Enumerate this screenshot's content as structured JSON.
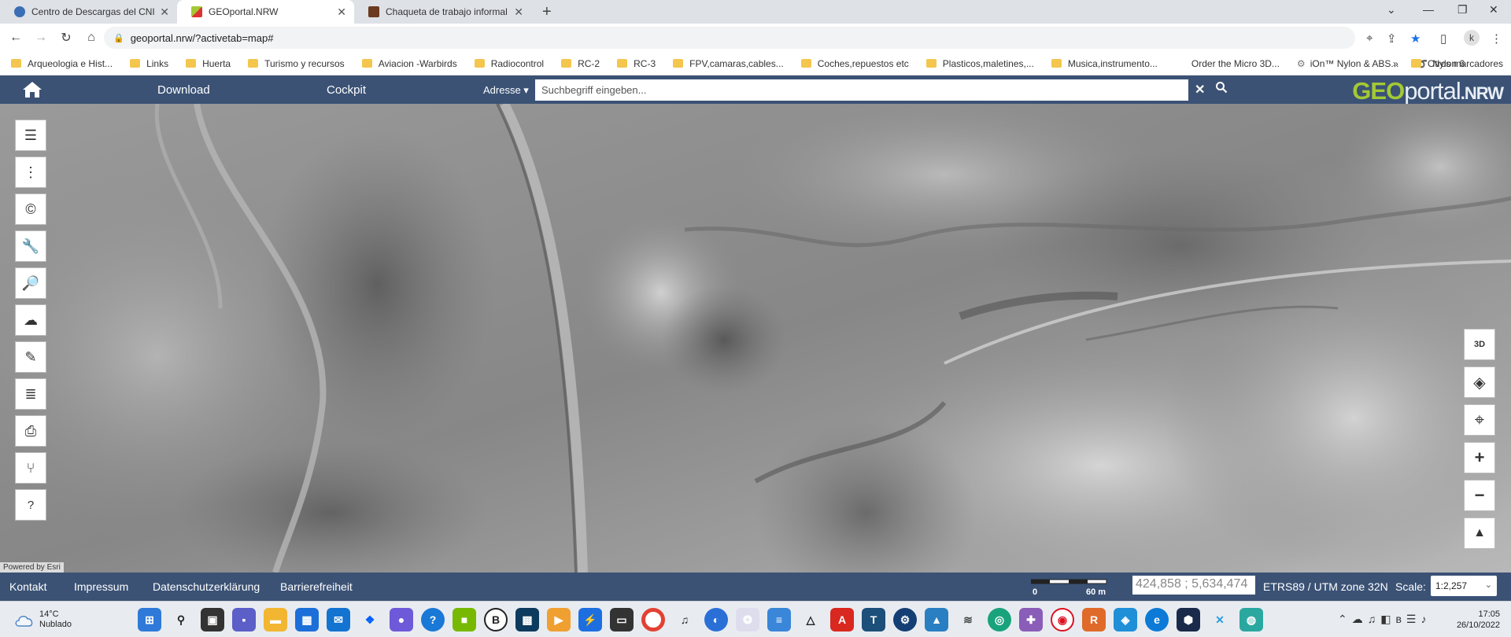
{
  "browser": {
    "tabs": [
      {
        "title": "Centro de Descargas del CNIG (IGN",
        "icon": "globe-icon",
        "active": false
      },
      {
        "title": "GEOportal.NRW",
        "icon": "geoportal-favicon",
        "active": true
      },
      {
        "title": "Chaqueta de trabajo informal cál",
        "icon": "shop-favicon",
        "active": false
      }
    ],
    "url": "geoportal.nrw/?activetab=map#",
    "profile_initial": "k",
    "bookmarks": [
      "Arqueologia e Hist...",
      "Links",
      "Huerta",
      "Turismo y recursos",
      "Aviacion -Warbirds",
      "Radiocontrol",
      "RC-2",
      "RC-3",
      "FPV,camaras,cables...",
      "Coches,repuestos etc",
      "Plasticos,maletines,...",
      "Musica,instrumento...",
      "Order the Micro 3D...",
      "iOn™ Nylon & ABS...",
      "Nylon 6"
    ],
    "bookmarks_more": "»",
    "bookmarks_other": "Otros marcadores"
  },
  "portal": {
    "nav": {
      "download": "Download",
      "cockpit": "Cockpit"
    },
    "search": {
      "scope": "Adresse ▾",
      "placeholder": "Suchbegriff eingeben..."
    },
    "logo": {
      "geo": "GEO",
      "portal": "portal",
      "nrw": ".NRW"
    },
    "colors": {
      "header": "#3b5275",
      "logo_green": "#a3c934"
    }
  },
  "left_tools": [
    {
      "name": "layer-list-icon",
      "glyph": "☰"
    },
    {
      "name": "more-menu-icon",
      "glyph": "⋮"
    },
    {
      "name": "copyright-icon",
      "glyph": "©"
    },
    {
      "name": "wrench-icon",
      "glyph": "🔧"
    },
    {
      "name": "search-document-icon",
      "glyph": "🔎"
    },
    {
      "name": "cloud-download-icon",
      "glyph": "☁"
    },
    {
      "name": "pen-icon",
      "glyph": "✎"
    },
    {
      "name": "layers-settings-icon",
      "glyph": "≣"
    },
    {
      "name": "print-icon",
      "glyph": "⎙"
    },
    {
      "name": "share-icon",
      "glyph": "⑂"
    },
    {
      "name": "help-icon",
      "glyph": "?"
    }
  ],
  "right_tools": [
    {
      "name": "3d-view-icon",
      "glyph": "3D"
    },
    {
      "name": "layers-icon",
      "glyph": "◈"
    },
    {
      "name": "locate-icon",
      "glyph": "⌖"
    },
    {
      "name": "zoom-in-icon",
      "glyph": "+"
    },
    {
      "name": "zoom-out-icon",
      "glyph": "−"
    },
    {
      "name": "compass-icon",
      "glyph": "▲"
    }
  ],
  "map": {
    "attribution": "Powered by Esri"
  },
  "footer": {
    "links": [
      "Kontakt",
      "Impressum",
      "Datenschutzerklärung",
      "Barrierefreiheit"
    ],
    "scale_start": "0",
    "scale_end": "60 m",
    "coords": "424,858 ; 5,634,474",
    "crs": "ETRS89 / UTM zone 32N",
    "scale_label": "Scale:",
    "scale_value": "1:2,257"
  },
  "taskbar": {
    "temperature": "14°C",
    "weather": "Nublado",
    "time": "17:05",
    "date": "26/10/2022"
  }
}
